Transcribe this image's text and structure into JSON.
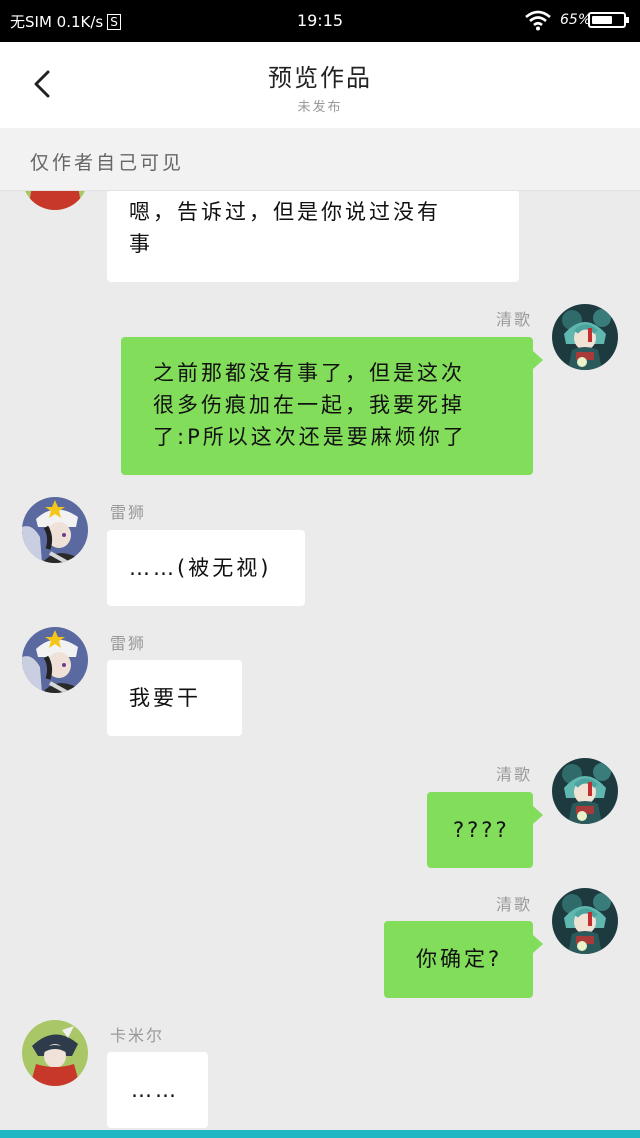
{
  "status_bar": {
    "carrier": "无SIM 0.1K/s",
    "sim_badge": "S",
    "time": "19:15",
    "battery_percent": "65%",
    "battery_level": 0.65
  },
  "header": {
    "title": "预览作品",
    "subtitle": "未发布"
  },
  "visibility_note": "仅作者自己可见",
  "messages": [
    {
      "side": "left",
      "sender": "",
      "avatar": "avatar-red-character",
      "text_lines": [
        "嗯，告诉过，但是你说过没有",
        "事"
      ]
    },
    {
      "side": "right",
      "sender": "清歌",
      "avatar": "avatar-qingge",
      "text_lines": [
        "之前那都没有事了，但是这次",
        "很多伤痕加在一起，我要死掉",
        "了:P所以这次还是要麻烦你了"
      ]
    },
    {
      "side": "left",
      "sender": "雷狮",
      "avatar": "avatar-leishi",
      "text_lines": [
        "……(被无视)"
      ]
    },
    {
      "side": "left",
      "sender": "雷狮",
      "avatar": "avatar-leishi",
      "text_lines": [
        "我要干"
      ]
    },
    {
      "side": "right",
      "sender": "清歌",
      "avatar": "avatar-qingge",
      "text_lines": [
        "????"
      ]
    },
    {
      "side": "right",
      "sender": "清歌",
      "avatar": "avatar-qingge",
      "text_lines": [
        "你确定?"
      ]
    },
    {
      "side": "left",
      "sender": "卡米尔",
      "avatar": "avatar-kamier",
      "text_lines": [
        "……"
      ]
    }
  ],
  "colors": {
    "background": "#ebebeb",
    "right_bubble": "#82dd5b",
    "left_bubble": "#ffffff",
    "bottom_accent": "#1fb7c4"
  }
}
